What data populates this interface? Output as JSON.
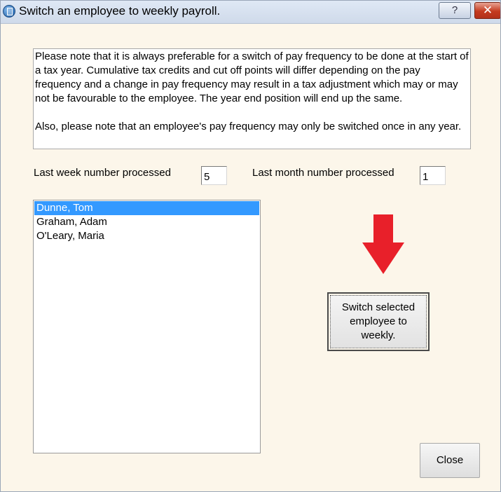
{
  "window": {
    "title": "Switch an employee to weekly payroll.",
    "help_label": "?",
    "close_label": "✕",
    "icon": "app-icon",
    "background_color": "#fcf6ea"
  },
  "notice": {
    "paragraph1": "Please note that it is always preferable for a switch of pay frequency to be done at the start of a tax year. Cumulative tax credits and cut off points will differ depending on the pay frequency and a change in pay frequency may result in a tax adjustment which may or may not be favourable to the employee. The year end position will end up the same.",
    "paragraph2": "Also, please note that an employee's pay frequency may only be switched once in any year."
  },
  "fields": {
    "last_week_label": "Last week number processed",
    "last_week_value": "5",
    "last_month_label": "Last month number processed",
    "last_month_value": "1"
  },
  "employees": {
    "items": [
      {
        "name": "Dunne, Tom",
        "selected": true
      },
      {
        "name": "Graham, Adam",
        "selected": false
      },
      {
        "name": "O'Leary, Maria",
        "selected": false
      }
    ],
    "selected_color": "#3399ff"
  },
  "arrow": {
    "icon": "down-arrow-icon",
    "color": "#e8202a"
  },
  "buttons": {
    "switch_label": "Switch selected employee to weekly.",
    "close_label": "Close"
  }
}
